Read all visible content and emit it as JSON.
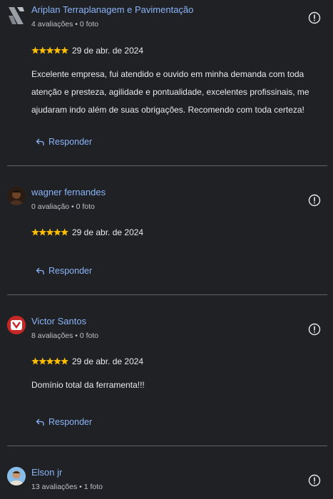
{
  "colors": {
    "background": "#202124",
    "link": "#8ab4f8",
    "star": "#fbbc04",
    "divider": "#5f6368"
  },
  "reviews": [
    {
      "name": "Ariplan Terraplanagem e Pavimentação",
      "meta": "4 avaliações • 0 foto",
      "rating": 5,
      "date": "29 de abr. de 2024",
      "text": "Excelente empresa, fui atendido e ouvido em minha demanda com toda atenção e presteza, agilidade e pontualidade, excelentes profissinais, me ajudaram indo além de suas obrigações. Recomendo com toda certeza!",
      "reply_label": "Responder"
    },
    {
      "name": "wagner fernandes",
      "meta": "0 avaliação • 0 foto",
      "rating": 5,
      "date": "29 de abr. de 2024",
      "text": "",
      "reply_label": "Responder"
    },
    {
      "name": "Victor Santos",
      "meta": "8 avaliações • 0 foto",
      "rating": 5,
      "date": "29 de abr. de 2024",
      "text": "Domínio total da ferramenta!!!",
      "reply_label": "Responder"
    },
    {
      "name": "Elson jr",
      "meta": "13 avaliações • 1 foto",
      "rating": null,
      "date": "",
      "text": "",
      "reply_label": ""
    }
  ]
}
